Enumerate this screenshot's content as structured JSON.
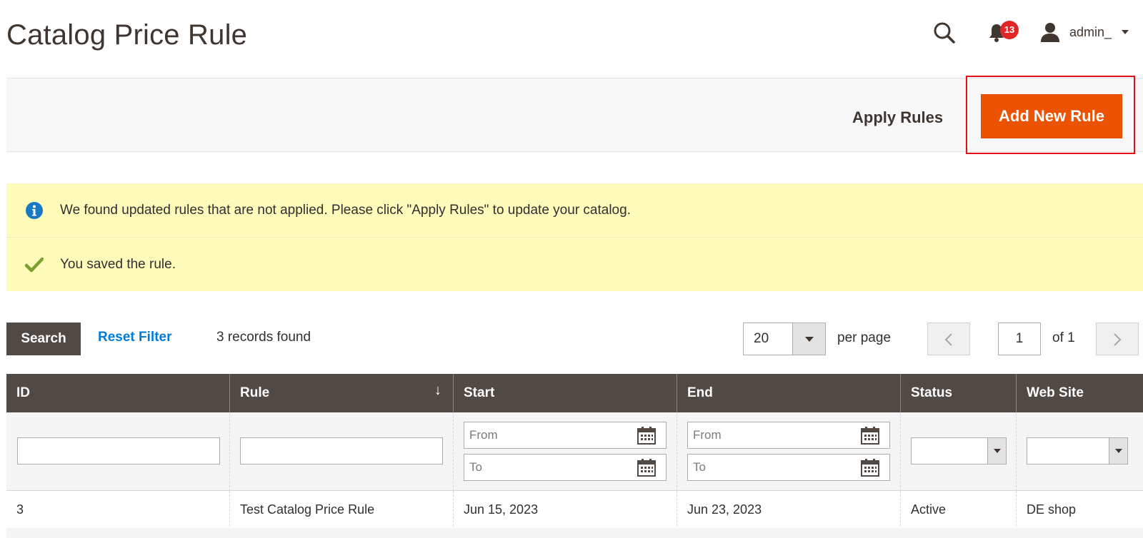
{
  "header": {
    "title": "Catalog Price Rule",
    "notifications_count": "13",
    "user_name": "admin_"
  },
  "actions": {
    "apply_label": "Apply Rules",
    "add_label": "Add New Rule",
    "accent_color": "#eb5202"
  },
  "messages": {
    "info": "We found updated rules that are not applied. Please click \"Apply Rules\" to update your catalog.",
    "success": "You saved the rule."
  },
  "toolbar": {
    "search_label": "Search",
    "reset_label": "Reset Filter",
    "records_text": "3 records found",
    "per_page_value": "20",
    "per_page_label": "per page",
    "page_value": "1",
    "page_of": "of 1"
  },
  "grid": {
    "columns": [
      "ID",
      "Rule",
      "Start",
      "End",
      "Status",
      "Web Site"
    ],
    "sorted_column_arrow": "↓",
    "filters": {
      "from_placeholder": "From",
      "to_placeholder": "To"
    },
    "rows": [
      [
        "3",
        "Test Catalog Price Rule",
        "Jun 15, 2023",
        "Jun 23, 2023",
        "Active",
        "DE shop"
      ]
    ]
  }
}
